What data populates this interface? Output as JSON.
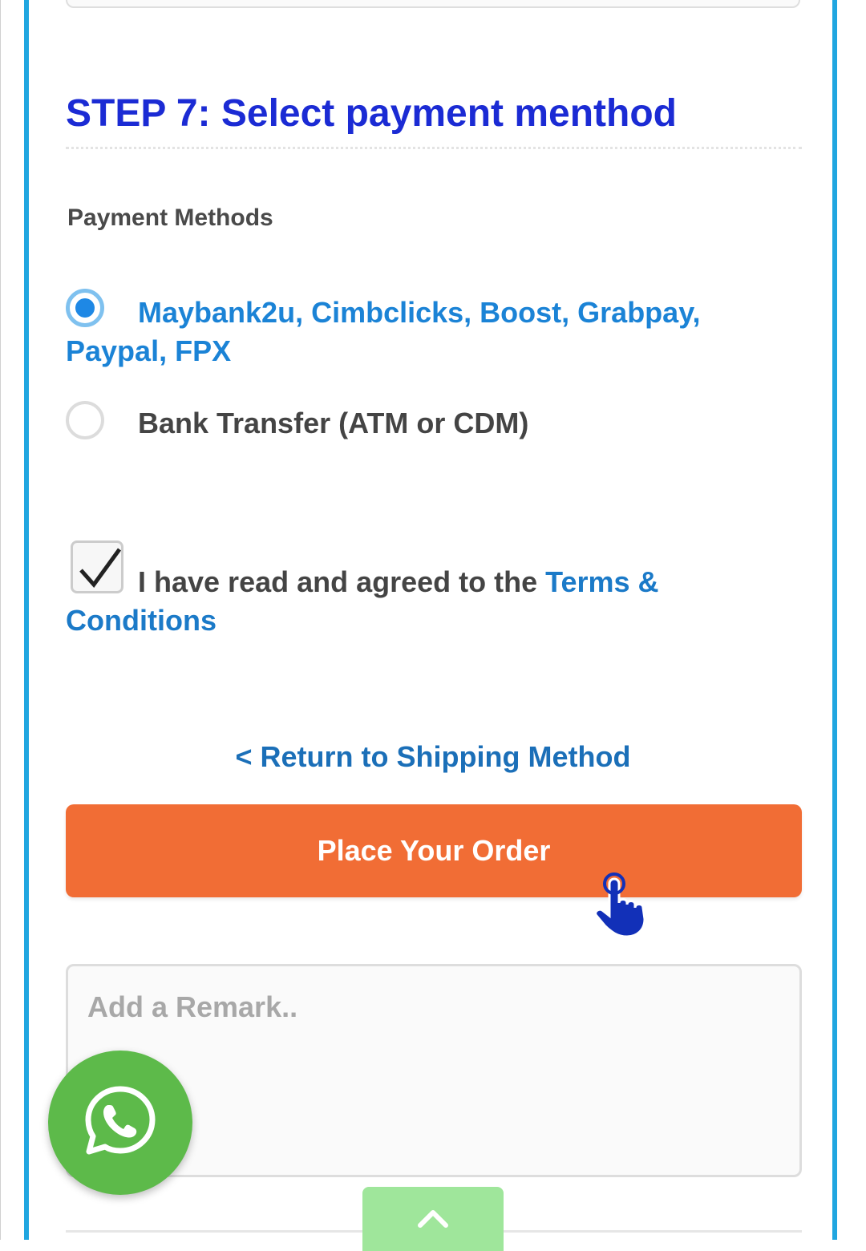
{
  "step_title": "STEP 7: Select payment menthod",
  "payment_section": {
    "label": "Payment Methods",
    "options": [
      {
        "label": "Maybank2u, Cimbclicks, Boost, Grabpay, Paypal, FPX",
        "selected": true
      },
      {
        "label": "Bank Transfer (ATM or CDM)",
        "selected": false
      }
    ]
  },
  "terms": {
    "checked": true,
    "text": "I have read and agreed to the ",
    "link_text": "Terms & Conditions"
  },
  "return_link": "< Return to Shipping Method",
  "place_order_label": "Place Your Order",
  "remark": {
    "placeholder": "Add a Remark..",
    "value": ""
  },
  "icons": {
    "pointer": "hand-pointer-icon",
    "whatsapp": "whatsapp-icon",
    "scroll_top": "chevron-up-icon"
  },
  "colors": {
    "frame_accent": "#20a6e0",
    "title": "#1b2bd4",
    "link": "#1b7ac8",
    "order_button": "#f16d35",
    "whatsapp": "#5dba4a",
    "scroll_top": "#9fe69b"
  }
}
